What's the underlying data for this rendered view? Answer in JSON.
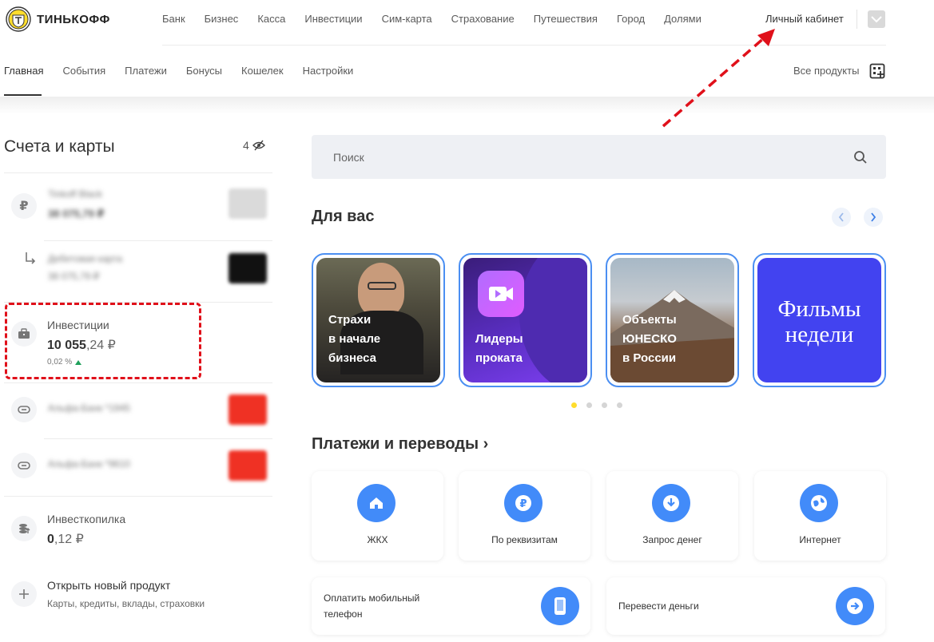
{
  "brand": {
    "name": "ТИНЬКОФФ"
  },
  "topnav": [
    "Банк",
    "Бизнес",
    "Касса",
    "Инвестиции",
    "Сим-карта",
    "Страхование",
    "Путешествия",
    "Город",
    "Долями"
  ],
  "header": {
    "cabinet": "Личный кабинет"
  },
  "subnav": {
    "items": [
      "Главная",
      "События",
      "Платежи",
      "Бонусы",
      "Кошелек",
      "Настройки"
    ],
    "active": "Главная",
    "all_products": "Все продукты"
  },
  "accounts": {
    "title": "Счета и карты",
    "count": "4",
    "items": [
      {
        "name": "Tinkoff Black",
        "amount": "38 075,79 ₽",
        "blurred": true,
        "icon": "ruble-icon"
      },
      {
        "name": "Дебетовая карта",
        "amount": "38 075,79 ₽",
        "blurred": true,
        "icon": "sub-arrow-icon"
      },
      {
        "name": "Инвестиции",
        "amount_int": "10 055",
        "amount_frac": ",24 ₽",
        "change": "0,02 %",
        "icon": "briefcase-icon"
      },
      {
        "name": "Альфа-Банк *1945",
        "blurred": true,
        "icon": "link-icon"
      },
      {
        "name": "Альфа-Банк *9610",
        "blurred": true,
        "icon": "link-icon"
      },
      {
        "name": "Инвесткопилка",
        "amount_int": "0",
        "amount_frac": ",12 ₽",
        "icon": "coins-icon"
      }
    ],
    "open_new": {
      "title": "Открыть новый продукт",
      "subtitle": "Карты, кредиты, вклады, страховки"
    }
  },
  "search": {
    "placeholder": "Поиск"
  },
  "for_you": {
    "title": "Для вас",
    "stories": [
      {
        "label": "Страхи\nв начале\nбизнеса"
      },
      {
        "label": "Лидеры\nпроката"
      },
      {
        "label": "Объекты\nЮНЕСКО\nв России"
      },
      {
        "label": "Фильмы\nнедели"
      }
    ],
    "dots": 4,
    "active_dot": 0
  },
  "payments": {
    "title": "Платежи и переводы ›",
    "tiles": [
      {
        "label": "ЖКХ",
        "icon": "home-icon"
      },
      {
        "label": "По реквизитам",
        "icon": "ruble-icon"
      },
      {
        "label": "Запрос денег",
        "icon": "download-icon"
      },
      {
        "label": "Интернет",
        "icon": "globe-icon"
      }
    ],
    "wide": [
      {
        "label": "Оплатить мобильный\nтелефон",
        "icon": "phone-icon"
      },
      {
        "label": "Перевести деньги",
        "icon": "arrow-right-icon"
      }
    ]
  },
  "colors": {
    "accent": "#428bf9",
    "annotation": "#e0101a",
    "brand_yellow": "#ffdd2d",
    "up": "#1fa05b"
  }
}
